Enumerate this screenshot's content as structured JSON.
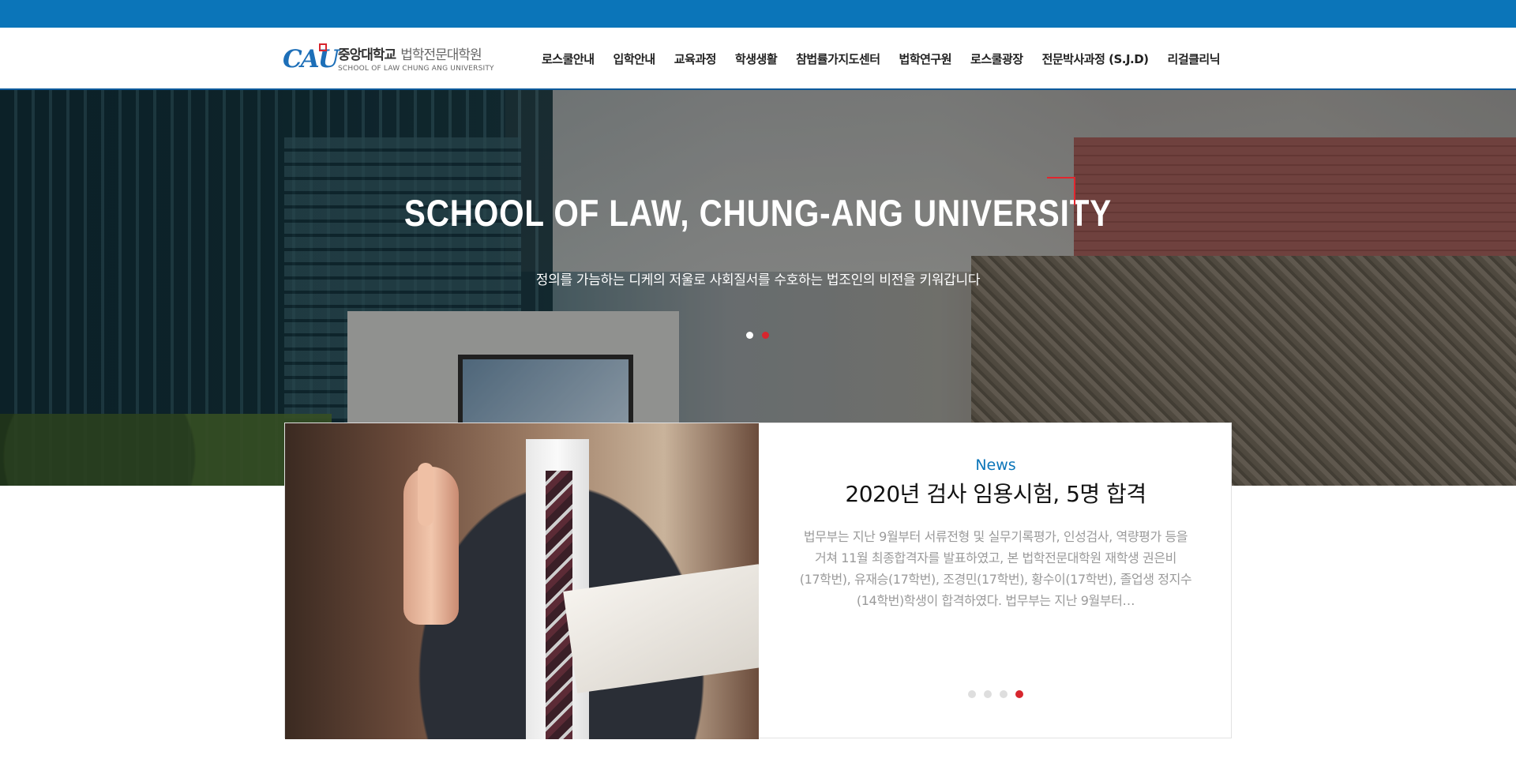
{
  "header": {
    "logo": {
      "mark": "CAU",
      "name_ko": "중앙대학교",
      "name_ko_sub": "법학전문대학원",
      "name_en": "SCHOOL OF LAW CHUNG ANG UNIVERSITY"
    },
    "nav": [
      {
        "label": "로스쿨안내"
      },
      {
        "label": "입학안내"
      },
      {
        "label": "교육과정"
      },
      {
        "label": "학생생활"
      },
      {
        "label": "참법률가지도센터"
      },
      {
        "label": "법학연구원"
      },
      {
        "label": "로스쿨광장"
      },
      {
        "label": "전문박사과정 (S.J.D)"
      },
      {
        "label": "리걸클리닉"
      }
    ]
  },
  "hero": {
    "title": "SCHOOL OF LAW, CHUNG-ANG UNIVERSITY",
    "subtitle": "정의를 가늠하는 디케의 저울로 사회질서를 수호하는 법조인의 비전을 키워갑니다",
    "slides_total": 2,
    "active_slide": 2
  },
  "news": {
    "label": "News",
    "title": "2020년 검사 임용시험, 5명 합격",
    "body": "법무부는 지난 9월부터 서류전형 및 실무기록평가, 인성검사, 역량평가 등을 거쳐 11월 최종합격자를 발표하였고, 본 법학전문대학원 재학생 권은비(17학번), 유재승(17학번), 조경민(17학번), 황수이(17학번), 졸업생 정지수(14학번)학생이 합격하였다. 법무부는 지난 9월부터…",
    "slides_total": 4,
    "active_slide": 4
  },
  "colors": {
    "brand_blue": "#0b75b9",
    "accent_red": "#d7262e"
  }
}
